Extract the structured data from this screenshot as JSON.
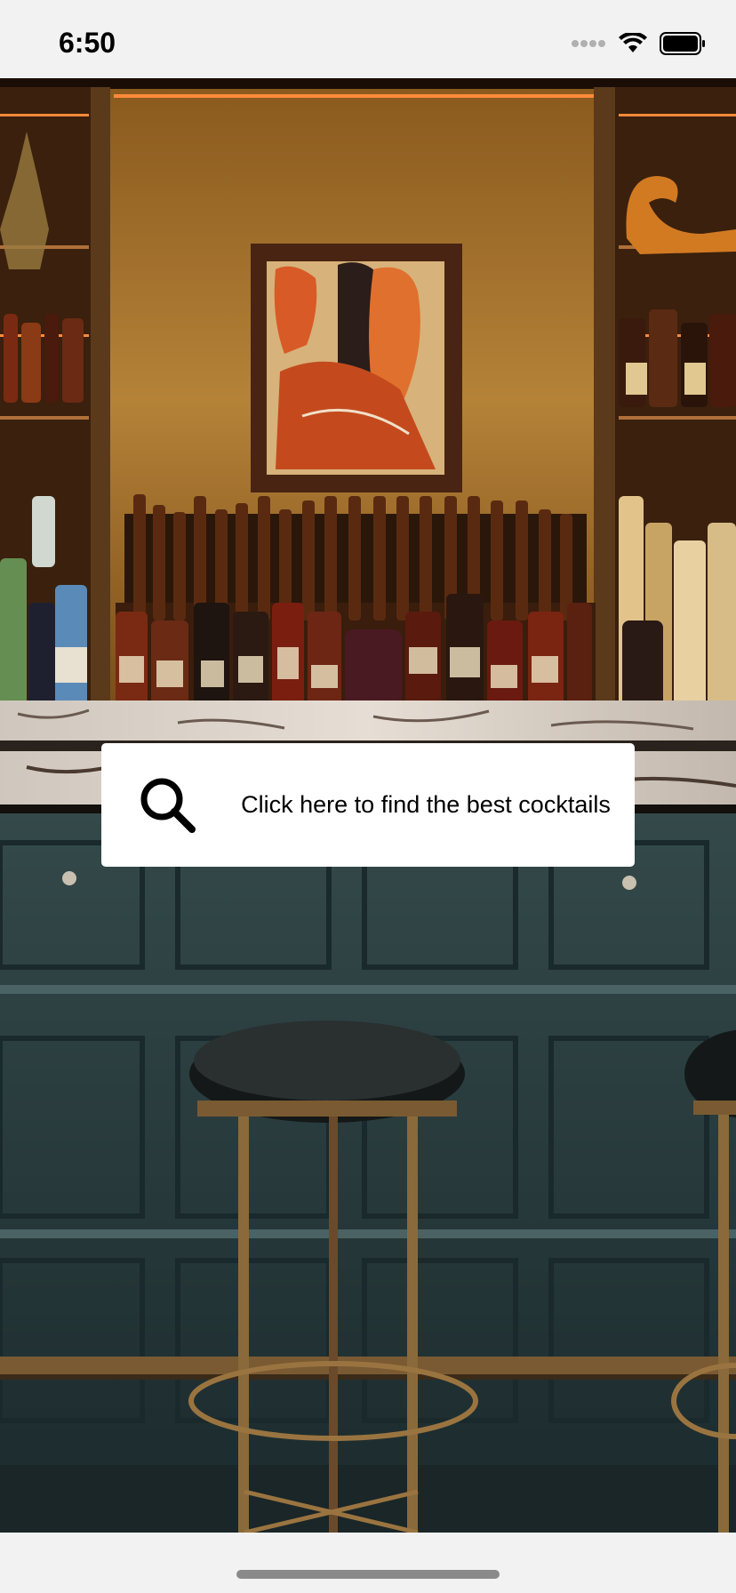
{
  "status_bar": {
    "time": "6:50",
    "icons": [
      "signal-dots-icon",
      "wifi-icon",
      "battery-icon"
    ]
  },
  "background": {
    "description_icon": "bar-interior-photo",
    "colors": {
      "wall": "#b57a2e",
      "panel": "#2b3f40",
      "brass": "#8a6a3a"
    }
  },
  "search_card": {
    "icon": "search-icon",
    "prompt": "Click here to find the best cocktails"
  }
}
